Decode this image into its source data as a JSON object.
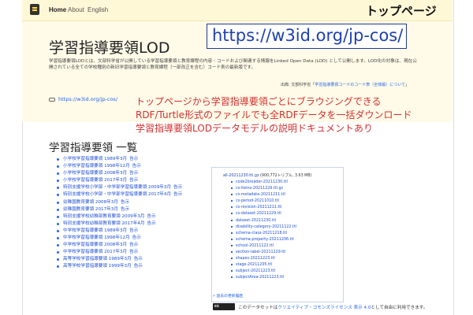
{
  "nav": {
    "items": [
      "Home",
      "About",
      "English"
    ]
  },
  "banner_label": "トップページ",
  "url_box": "https://w3id.org/jp-cos/",
  "hero": {
    "title": "学習指導要領LOD",
    "description": "学習指導要領LODとは、文部科学省が公開している学習指導要領と教育課程の内容・コードおよび関連する情報をLinked Open Data (LOD) として公開します。LOD化の対象は、現在公開されている全ての学校種別の新旧学習指導要領と教育課程（一部改正を含む）コード表の最新版です。",
    "source_prefix": "出典: 文部科学省「",
    "source_link": "学習指導要領コードのコード表（全体版）について",
    "source_suffix": "」",
    "link": "https://w3id.org/jp-cos/"
  },
  "annotations": [
    "トップページから学習指導要領ごとにブラウジングできる",
    "RDF/Turtle形式のファイルでも全RDFデータを一括ダウンロード",
    "学習指導要領LODデータモデルの説明ドキュメントあり"
  ],
  "list": {
    "heading": "学習指導要領 一覧",
    "items": [
      {
        "label": "小学校学習指導要領 1989年3月",
        "extra": "告示"
      },
      {
        "label": "小学校学習指導要領 1998年12月",
        "extra": "告示"
      },
      {
        "label": "小学校学習指導要領 2008年3月",
        "extra": "告示"
      },
      {
        "label": "小学校学習指導要領 2017年3月",
        "extra": "告示"
      },
      {
        "label": "特別支援学校小学部・中学部学習指導要領 2009年3月",
        "extra": "告示"
      },
      {
        "label": "特別支援学校小学部・中学部学習指導要領 2017年4月",
        "extra": "告示"
      },
      {
        "label": "幼稚園教育要領 2008年3月",
        "extra": "告示"
      },
      {
        "label": "幼稚園教育要領 2017年3月",
        "extra": "告示"
      },
      {
        "label": "特別支援学校幼稚部教育要領 2009年3月",
        "extra": "告示"
      },
      {
        "label": "特別支援学校幼稚部教育要領 2017年4月",
        "extra": "告示"
      },
      {
        "label": "中学校学習指導要領 1989年3月",
        "extra": "告示"
      },
      {
        "label": "中学校学習指導要領 1998年12月",
        "extra": "告示"
      },
      {
        "label": "中学校学習指導要領 2008年3月",
        "extra": "告示"
      },
      {
        "label": "中学校学習指導要領 2017年3月",
        "extra": "告示"
      },
      {
        "label": "高等学校学習指導要領 1989年3月",
        "extra": "告示"
      },
      {
        "label": "高等学校学習指導要領 1999年3月",
        "extra": "告示"
      }
    ]
  },
  "files": {
    "root": "all-20211230.ttl.gz",
    "root_meta": "(900,772トリプル, 3.63 MB)",
    "items": [
      "code2broader-20211230.ttl",
      "cs-items-20211229.ttl.gz",
      "cs-metadata-20211211.ttl",
      "cs-period-20211010.ttl",
      "cs-revision-20211211.ttl",
      "cs-dataset-20211229.ttl",
      "dataset-20211230.ttl",
      "disability-category-20211122.ttl",
      "schema-class-20211218.ttl",
      "schema-property-20211206.ttl",
      "school-20211122.ttl",
      "section-label-20211229.ttl",
      "shapes-20211223.ttl",
      "stage-20211205.ttl",
      "subject-20211223.ttl",
      "subjectArea-20211223.ttl"
    ],
    "history_link": "» 過去の更新履歴"
  },
  "license": {
    "prefix": "このデータセットは",
    "link": "クリエイティブ・コモンズライセンス 表示 4.0",
    "suffix": "として自由に利用できます。"
  }
}
